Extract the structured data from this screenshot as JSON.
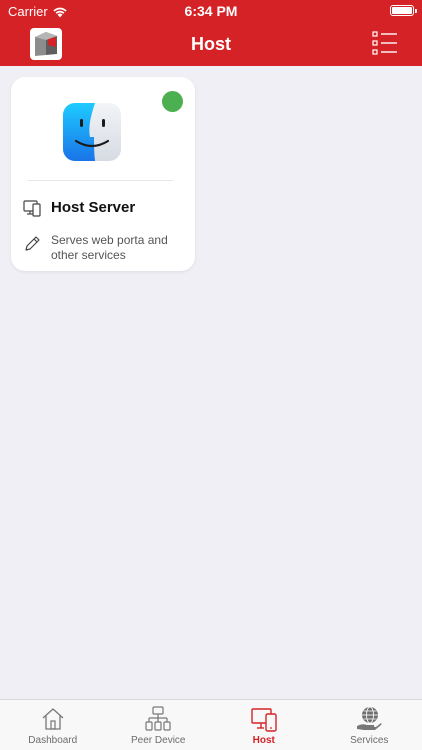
{
  "status_bar": {
    "carrier": "Carrier",
    "time": "6:34 PM"
  },
  "nav": {
    "title": "Host",
    "logo_icon": "app-logo-icon",
    "menu_icon": "list-menu-icon"
  },
  "host_card": {
    "name": "Host Server",
    "description": "Serves web porta and other services",
    "status": "online",
    "status_color": "#4caf50",
    "app_icon": "finder-icon",
    "device_icon": "devices-icon",
    "edit_icon": "pencil-icon"
  },
  "tabs": [
    {
      "label": "Dashboard",
      "icon": "home-icon",
      "active": false
    },
    {
      "label": "Peer Device",
      "icon": "network-icon",
      "active": false
    },
    {
      "label": "Host",
      "icon": "devices-icon",
      "active": true
    },
    {
      "label": "Services",
      "icon": "globe-hand-icon",
      "active": false
    }
  ],
  "colors": {
    "brand": "#d42226",
    "background": "#f0eff5",
    "online": "#4caf50"
  }
}
